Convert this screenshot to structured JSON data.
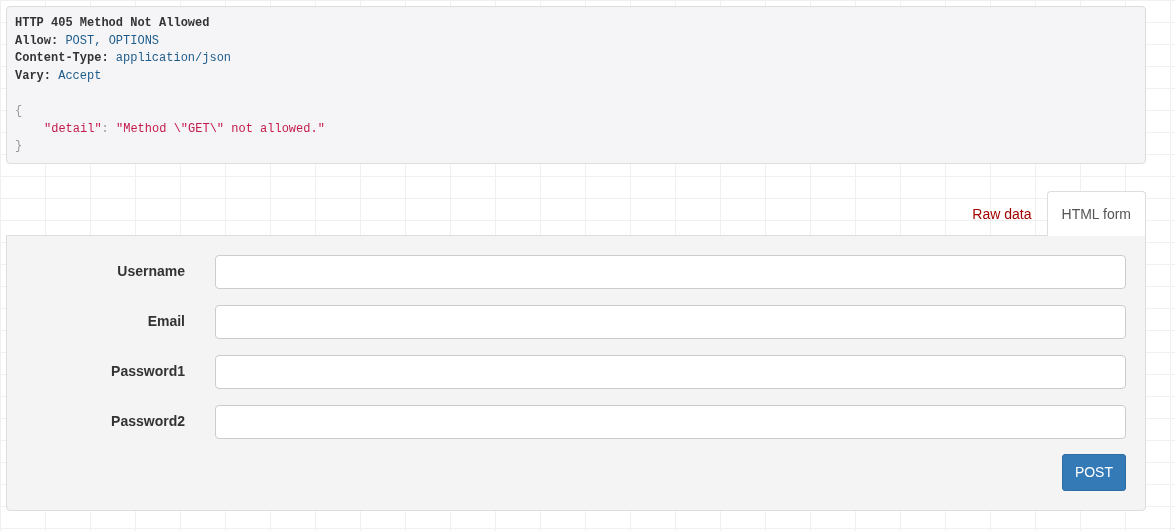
{
  "response": {
    "status_line": "HTTP 405 Method Not Allowed",
    "headers": [
      {
        "name": "Allow:",
        "value": "POST, OPTIONS"
      },
      {
        "name": "Content-Type:",
        "value": "application/json"
      },
      {
        "name": "Vary:",
        "value": "Accept"
      }
    ],
    "body": {
      "open": "{",
      "key": "\"detail\"",
      "colon": ":",
      "value": "\"Method \\\"GET\\\" not allowed.\"",
      "close": "}"
    }
  },
  "tabs": [
    {
      "label": "Raw data",
      "selected": false
    },
    {
      "label": "HTML form",
      "selected": true
    }
  ],
  "form": {
    "fields": [
      {
        "label": "Username"
      },
      {
        "label": "Email"
      },
      {
        "label": "Password1"
      },
      {
        "label": "Password2"
      }
    ],
    "submit": "POST"
  }
}
